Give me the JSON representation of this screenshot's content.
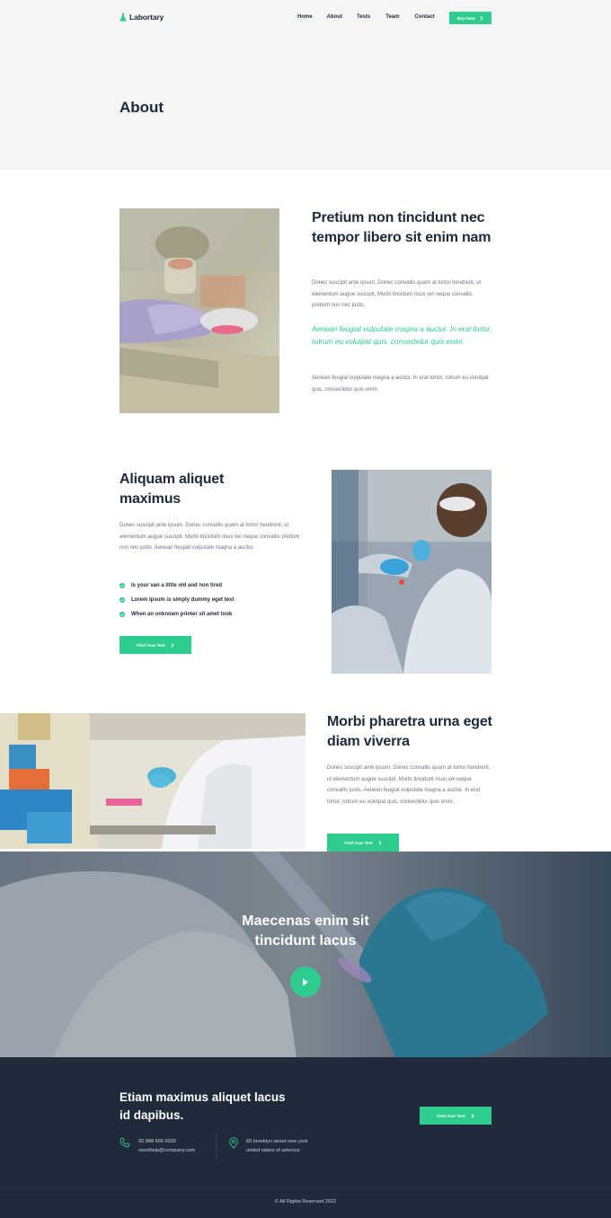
{
  "nav": {
    "logo": "Labortary",
    "links": [
      "Home",
      "About",
      "Tests",
      "Team",
      "Contact"
    ],
    "buy_label": "Buy Now"
  },
  "page": {
    "title": "About"
  },
  "section1": {
    "heading": "Pretium non tincidunt nec tempor libero sit enim nam",
    "para1": "Donec suscipit ante ipsum. Donec convallis quam at tortor hendrerit, ut elementum augue suscipit. Morbi tincidunt risus vel neque convallis pretium non nec justo.",
    "quote": "Aenean feugiat vulputate magna a auctor. In erat tortor, rutrum eu volutpat quis, consectetur quis enim.",
    "para2": "Aenean feugiat vulputate magna a auctor. In erat tortor, rutrum eu volutpat quis, consectetur quis enim."
  },
  "section2": {
    "heading": "Aliquam aliquet maximus",
    "para": "Donec suscipit ante ipsum. Donec convallis quam at tortor hendrerit, ut elementum augue suscipit. Morbi tincidunt risus vel neque convallis pretium non nec justo. Aenean feugiat vulputate magna a auctor.",
    "checklist": [
      "Is your van a little old and non tired",
      "Lorem Ipsum is simply dummy eget text",
      "When an unknown printer sit amet took"
    ],
    "button": "Find Your Test"
  },
  "section3": {
    "heading": "Morbi pharetra urna eget diam viverra",
    "para": "Donec suscipit ante ipsum. Donec convallis quam at tortor hendrerit, ut elementum augue suscipit. Morbi tincidunt risus vel neque convallis justo. Aenean feugiat vulputate magna a auctor. In erat tortor, rutrum eu volutpat quis, consectetur quis enim.",
    "button": "Find Your Test"
  },
  "video": {
    "title": "Maecenas enim sit tincidunt lacus"
  },
  "footer": {
    "title": "Etiam maximus aliquet lacus id dapibus.",
    "button": "Find Your Test",
    "phone": "92 888 666 0000",
    "email": "needhelp@company.com",
    "address1": "60 brooklyn street new york",
    "address2": "united states of america",
    "copyright": "© All Rights Reserved 2022"
  },
  "colors": {
    "accent": "#2ecc8f",
    "dark": "#1f2b3b",
    "heading": "#1d2a3a",
    "header_bg": "#f5f5f5"
  },
  "icons": [
    "flask-icon",
    "chevron-right-icon",
    "check-circle-icon",
    "play-icon",
    "phone-icon",
    "location-pin-icon"
  ]
}
